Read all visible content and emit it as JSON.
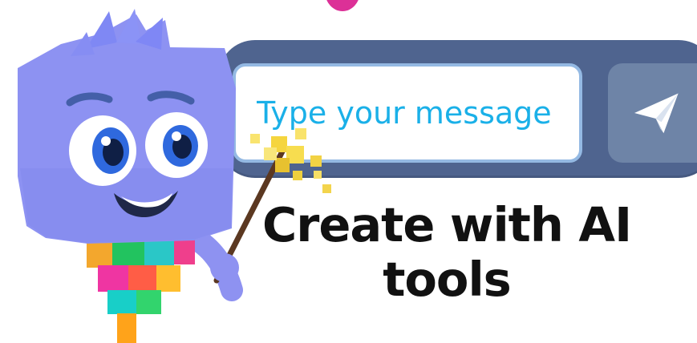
{
  "decorations": {
    "top_accent_color": "#d8198c"
  },
  "chat": {
    "placeholder": "Type your message",
    "send_icon": "paper-plane-icon",
    "bar_color": "#4f648f",
    "input_text_color": "#1ab0e8",
    "button_color": "#6e84a7"
  },
  "hero": {
    "headline": "Create with AI tools"
  },
  "mascot": {
    "body_color": "#8d92f2",
    "wand_color": "#f4d33d"
  }
}
